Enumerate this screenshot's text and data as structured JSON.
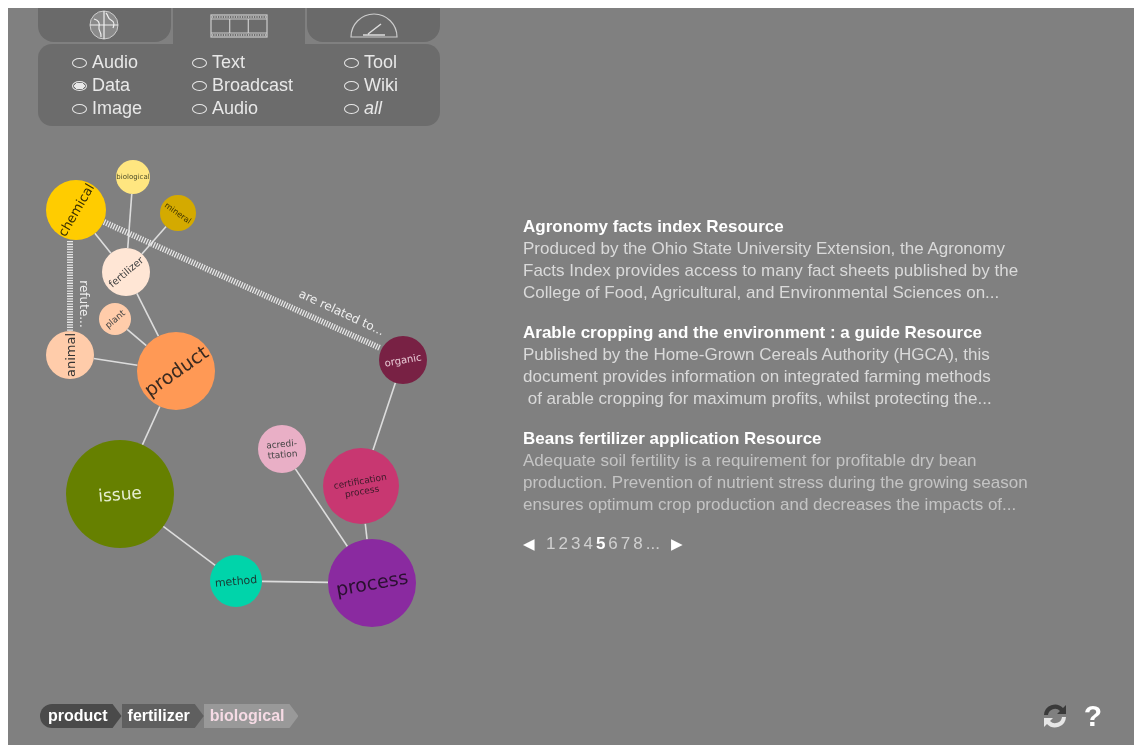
{
  "tabs": [
    {
      "selected": false
    },
    {
      "selected": true
    },
    {
      "selected": false
    }
  ],
  "filters": [
    {
      "label": "Audio",
      "selected": false
    },
    {
      "label": "Data",
      "selected": true
    },
    {
      "label": "Image",
      "selected": false
    },
    {
      "label": "Text",
      "selected": false
    },
    {
      "label": "Broadcast",
      "selected": false
    },
    {
      "label": "Audio",
      "selected": false
    },
    {
      "label": "Tool",
      "selected": false
    },
    {
      "label": "Wiki",
      "selected": false
    },
    {
      "label": "all",
      "selected": false,
      "kind": "all"
    }
  ],
  "graph": {
    "nodes": [
      {
        "label": "biological",
        "color": "#ffe680"
      },
      {
        "label": "chemical",
        "color": "#ffcc00"
      },
      {
        "label": "mineral",
        "color": "#d4aa00"
      },
      {
        "label": "fertilizer",
        "color": "#ffe6d5"
      },
      {
        "label": "plant",
        "color": "#ffccaa"
      },
      {
        "label": "animal",
        "color": "#ffccaa"
      },
      {
        "label": "product",
        "color": "#ff9955"
      },
      {
        "label": "organic",
        "color": "#782144"
      },
      {
        "label": "acredi-\nttation",
        "color": "#e9afc6"
      },
      {
        "label": "certification\nprocess",
        "color": "#c83771"
      },
      {
        "label": "issue",
        "color": "#668000"
      },
      {
        "label": "method",
        "color": "#00d4aa"
      },
      {
        "label": "process",
        "color": "#8a2aa0"
      }
    ],
    "relations": [
      {
        "label": "refute..."
      },
      {
        "label": "are related to..."
      }
    ]
  },
  "results": [
    {
      "title": "Agronomy facts index Resource",
      "text": "Produced by the Ohio State University Extension, the Agronomy\nFacts Index provides access to many fact sheets published by the\nCollege of Food, Agricultural, and Environmental Sciences on..."
    },
    {
      "title": "Arable cropping and the environment : a guide Resource",
      "text": "Published by the Home-Grown Cereals Authority (HGCA), this\ndocument provides information on integrated farming methods\n of arable cropping for maximum profits, whilst protecting the..."
    },
    {
      "title": "Beans fertilizer application Resource",
      "text": "Adequate soil fertility is a requirement for profitable dry bean\nproduction. Prevention of nutrient stress during the growing season\nensures optimum crop production and decreases the impacts of..."
    }
  ],
  "pagination": {
    "prev": "◀",
    "pages": [
      {
        "label": "1",
        "selected": false
      },
      {
        "label": "2",
        "selected": false
      },
      {
        "label": "3",
        "selected": false
      },
      {
        "label": "4",
        "selected": false
      },
      {
        "label": "5",
        "selected": true
      },
      {
        "label": "6",
        "selected": false
      },
      {
        "label": "7",
        "selected": false
      },
      {
        "label": "8",
        "selected": false
      }
    ],
    "more": "...",
    "next": "▶"
  },
  "breadcrumb": [
    "product",
    "fertilizer",
    "biological"
  ],
  "help": "?"
}
